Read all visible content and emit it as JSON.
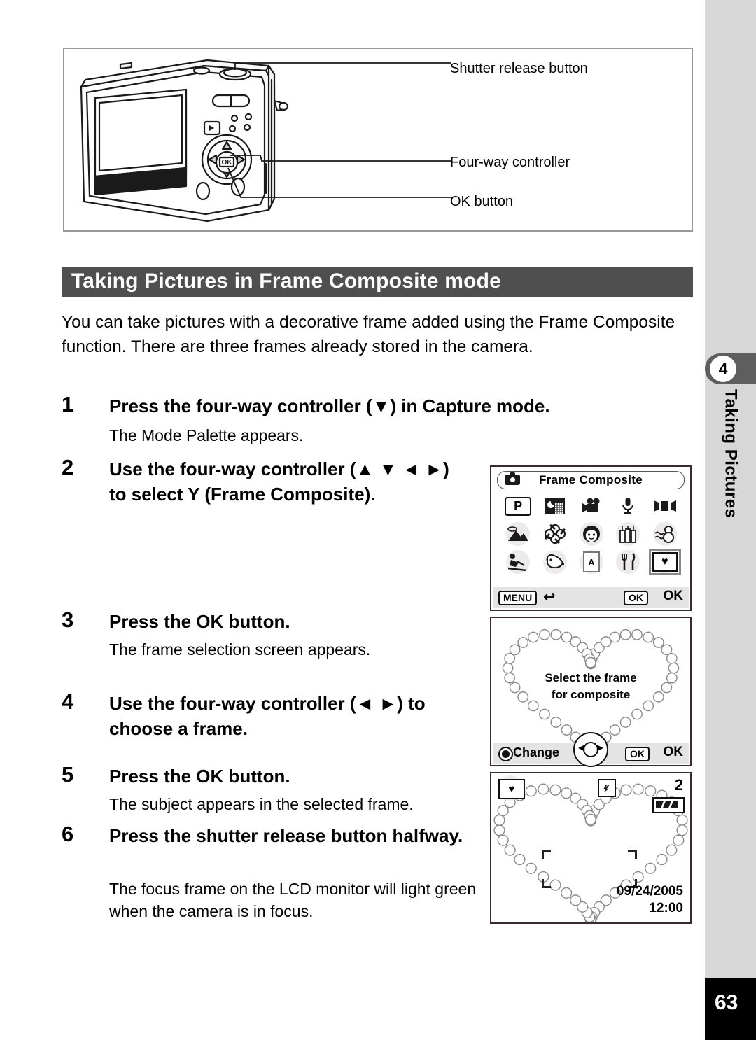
{
  "diagram": {
    "labels": {
      "shutter": "Shutter release button",
      "fourway": "Four-way controller",
      "ok": "OK button"
    }
  },
  "heading": {
    "title": "Taking Pictures in Frame Composite mode"
  },
  "intro": "You can take pictures with a decorative frame added using the Frame Composite function. There are three frames already stored in the camera.",
  "steps": [
    {
      "number": "1",
      "title": "Press the four-way controller (▼) in Capture mode.",
      "desc": "The Mode Palette appears."
    },
    {
      "number": "2",
      "title": "Use the four-way controller (▲ ▼ ◄ ►) to select Y (Frame Composite).",
      "desc": ""
    },
    {
      "number": "3",
      "title": "Press the OK button.",
      "desc": "The frame selection screen appears."
    },
    {
      "number": "4",
      "title": "Use the four-way controller (◄ ►) to choose a frame.",
      "desc": ""
    },
    {
      "number": "5",
      "title": "Press the OK button.",
      "desc": "The subject appears in the selected frame."
    },
    {
      "number": "6",
      "title": "Press the shutter release button halfway.",
      "desc": "The focus frame on the LCD monitor will light green when the camera is in focus."
    }
  ],
  "lcd_mode_palette": {
    "title": "Frame Composite",
    "icons": [
      {
        "name": "program-mode-icon",
        "glyph": "P",
        "type": "p"
      },
      {
        "name": "night-scene-icon",
        "glyph": "🌃",
        "type": "glyph"
      },
      {
        "name": "movie-mode-icon",
        "glyph": "🎥",
        "type": "glyph"
      },
      {
        "name": "voice-recording-icon",
        "glyph": "🎙",
        "type": "glyph"
      },
      {
        "name": "panorama-assist-icon",
        "glyph": "▶■◀",
        "type": "pano"
      },
      {
        "name": "landscape-mode-icon",
        "glyph": "⛰",
        "type": "glyph"
      },
      {
        "name": "flower-mode-icon",
        "glyph": "❀",
        "type": "glyph"
      },
      {
        "name": "portrait-mode-icon",
        "glyph": "👧",
        "type": "glyph"
      },
      {
        "name": "surf-and-snow-icon",
        "glyph": "☈",
        "type": "candles"
      },
      {
        "name": "snowman-mode-icon",
        "glyph": "☃",
        "type": "glyph"
      },
      {
        "name": "sport-mode-icon",
        "glyph": "🏃",
        "type": "glyph"
      },
      {
        "name": "pet-mode-icon",
        "glyph": "🐕",
        "type": "glyph"
      },
      {
        "name": "text-mode-icon",
        "glyph": "A",
        "type": "text"
      },
      {
        "name": "food-mode-icon",
        "glyph": "🍴",
        "type": "glyph"
      },
      {
        "name": "frame-composite-icon",
        "glyph": "♥",
        "type": "frame"
      }
    ],
    "selected_index": 14,
    "footer": {
      "menu_key": "MENU",
      "back_arrow": "↩",
      "ok_key": "OK",
      "ok_label": "OK"
    }
  },
  "lcd_frame_select": {
    "caption_line1": "Select the frame",
    "caption_line2": "for composite",
    "change_label": "Change",
    "ok_key": "OK",
    "ok_label": "OK"
  },
  "lcd_live_view": {
    "mode_icon": "♥",
    "flash_icon": "☀",
    "shots_remaining": "2",
    "date": "09/24/2005",
    "time": "12:00"
  },
  "sidebar": {
    "chapter_number": "4",
    "chapter_label": "Taking Pictures"
  },
  "footer": {
    "page_number": "63"
  },
  "colors": {
    "heading_bar": "#4f4f4f",
    "sidebar": "#d7d7d7",
    "tab": "#5e5e5e",
    "page_box": "#000000"
  }
}
